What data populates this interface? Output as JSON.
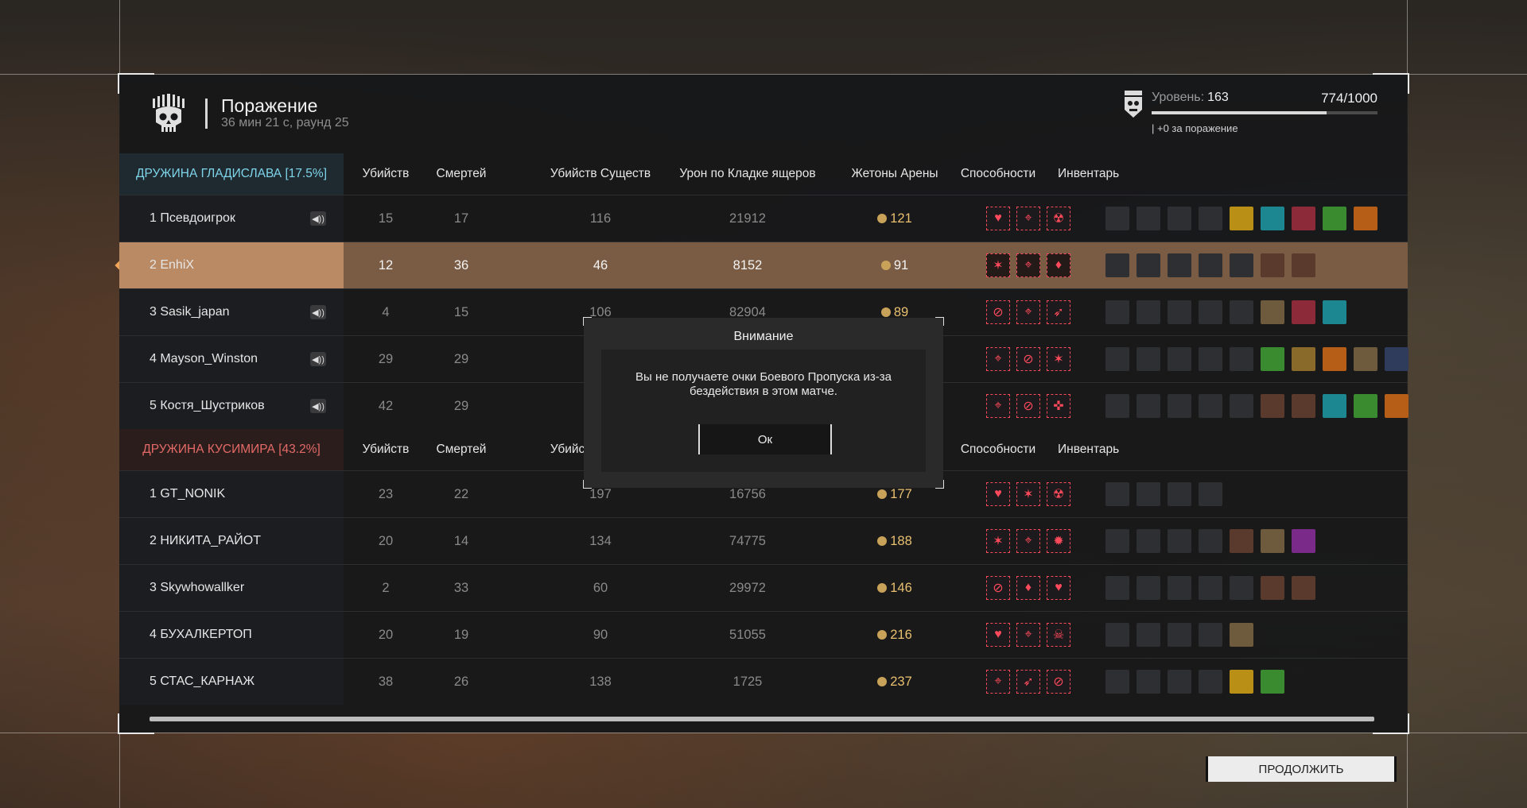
{
  "header": {
    "title": "Поражение",
    "subtitle": "36 мин 21 с, раунд 25",
    "level_label": "Уровень:",
    "level_value": "163",
    "xp_text": "774/1000",
    "xp_progress": 0.774,
    "level_note": "| +0 за поражение"
  },
  "columns": {
    "kills": "Убийств",
    "deaths": "Смертей",
    "creature_kills": "Убийств Существ",
    "damage": "Урон по Кладке ящеров",
    "tokens": "Жетоны Арены",
    "abilities": "Способности",
    "inventory": "Инвентарь"
  },
  "teams": [
    {
      "name": "ДРУЖИНА ГЛАДИСЛАВА [17.5%]",
      "color": "#7fd4ea",
      "players": [
        {
          "label": "1 Псевдоигрок",
          "kills": "15",
          "deaths": "17",
          "creatures": "116",
          "damage": "21912",
          "tokens": "121",
          "voice": true,
          "abilities": [
            "shield-heart",
            "crosshair",
            "radiation"
          ],
          "inventory": [
            "s",
            "s",
            "s",
            "s",
            "y",
            "c",
            "r",
            "g",
            "o"
          ]
        },
        {
          "label": "2 EnhiX",
          "kills": "12",
          "deaths": "36",
          "creatures": "46",
          "damage": "8152",
          "tokens": "91",
          "voice": false,
          "me": true,
          "abilities": [
            "wings",
            "crosshair",
            "blood-plus"
          ],
          "inventory": [
            "s",
            "s",
            "s",
            "s",
            "s",
            "dk",
            "dk"
          ]
        },
        {
          "label": "3 Sasik_japan",
          "kills": "4",
          "deaths": "15",
          "creatures": "106",
          "damage": "82904",
          "tokens": "89",
          "voice": true,
          "abilities": [
            "no-sign",
            "crosshair",
            "sprint"
          ],
          "inventory": [
            "s",
            "s",
            "s",
            "s",
            "s",
            "br",
            "r",
            "c"
          ]
        },
        {
          "label": "4 Mayson_Winston",
          "kills": "29",
          "deaths": "29",
          "creatures": "",
          "damage": "",
          "tokens": "",
          "voice": true,
          "abilities": [
            "crosshair",
            "no-sign",
            "wings"
          ],
          "inventory": [
            "s",
            "s",
            "s",
            "s",
            "s",
            "g",
            "tan",
            "o",
            "br",
            "b"
          ]
        },
        {
          "label": "5 Костя_Шустриков",
          "kills": "42",
          "deaths": "29",
          "creatures": "",
          "damage": "",
          "tokens": "",
          "voice": true,
          "abilities": [
            "crosshair",
            "no-sign",
            "target-cross"
          ],
          "inventory": [
            "s",
            "s",
            "s",
            "s",
            "s",
            "dk",
            "dk",
            "c",
            "g",
            "o"
          ]
        }
      ]
    },
    {
      "name": "ДРУЖИНА КУСИМИРА [43.2%]",
      "color": "#e36a66",
      "players": [
        {
          "label": "1 GT_NONIK",
          "kills": "23",
          "deaths": "22",
          "creatures": "197",
          "damage": "16756",
          "tokens": "177",
          "voice": false,
          "abilities": [
            "shield-heart",
            "wings",
            "radiation"
          ],
          "inventory": [
            "s",
            "s",
            "s",
            "s"
          ]
        },
        {
          "label": "2 НИКИТА_РАЙОТ",
          "kills": "20",
          "deaths": "14",
          "creatures": "134",
          "damage": "74775",
          "tokens": "188",
          "voice": false,
          "abilities": [
            "wings",
            "crosshair",
            "skull-bug"
          ],
          "inventory": [
            "s",
            "s",
            "s",
            "s",
            "dk",
            "br",
            "p"
          ]
        },
        {
          "label": "3 Skywhowallker",
          "kills": "2",
          "deaths": "33",
          "creatures": "60",
          "damage": "29972",
          "tokens": "146",
          "voice": false,
          "abilities": [
            "no-sign",
            "blood-plus",
            "heart-plus"
          ],
          "inventory": [
            "s",
            "s",
            "s",
            "s",
            "s",
            "dk",
            "dk"
          ]
        },
        {
          "label": "4 БУХАЛКЕРТОП",
          "kills": "20",
          "deaths": "19",
          "creatures": "90",
          "damage": "51055",
          "tokens": "216",
          "voice": false,
          "abilities": [
            "heart-plus",
            "crosshair",
            "skull"
          ],
          "inventory": [
            "s",
            "s",
            "s",
            "s",
            "br"
          ]
        },
        {
          "label": "5 СТАС_КАРНАЖ",
          "kills": "38",
          "deaths": "26",
          "creatures": "138",
          "damage": "1725",
          "tokens": "237",
          "voice": false,
          "abilities": [
            "crosshair",
            "sprint",
            "no-sign"
          ],
          "inventory": [
            "s",
            "s",
            "s",
            "s",
            "y",
            "g"
          ]
        }
      ]
    }
  ],
  "modal": {
    "title": "Внимание",
    "text": "Вы не получаете очки Боевого Пропуска из-за бездействия в этом матче.",
    "ok": "Ок"
  },
  "continue_label": "ПРОДОЛЖИТЬ",
  "colors": {
    "ability": "#ff4a5c",
    "highlight_row": "#7a5c44",
    "team_a": "#7fd4ea",
    "team_b": "#e36a66",
    "token": "#e8c070"
  }
}
